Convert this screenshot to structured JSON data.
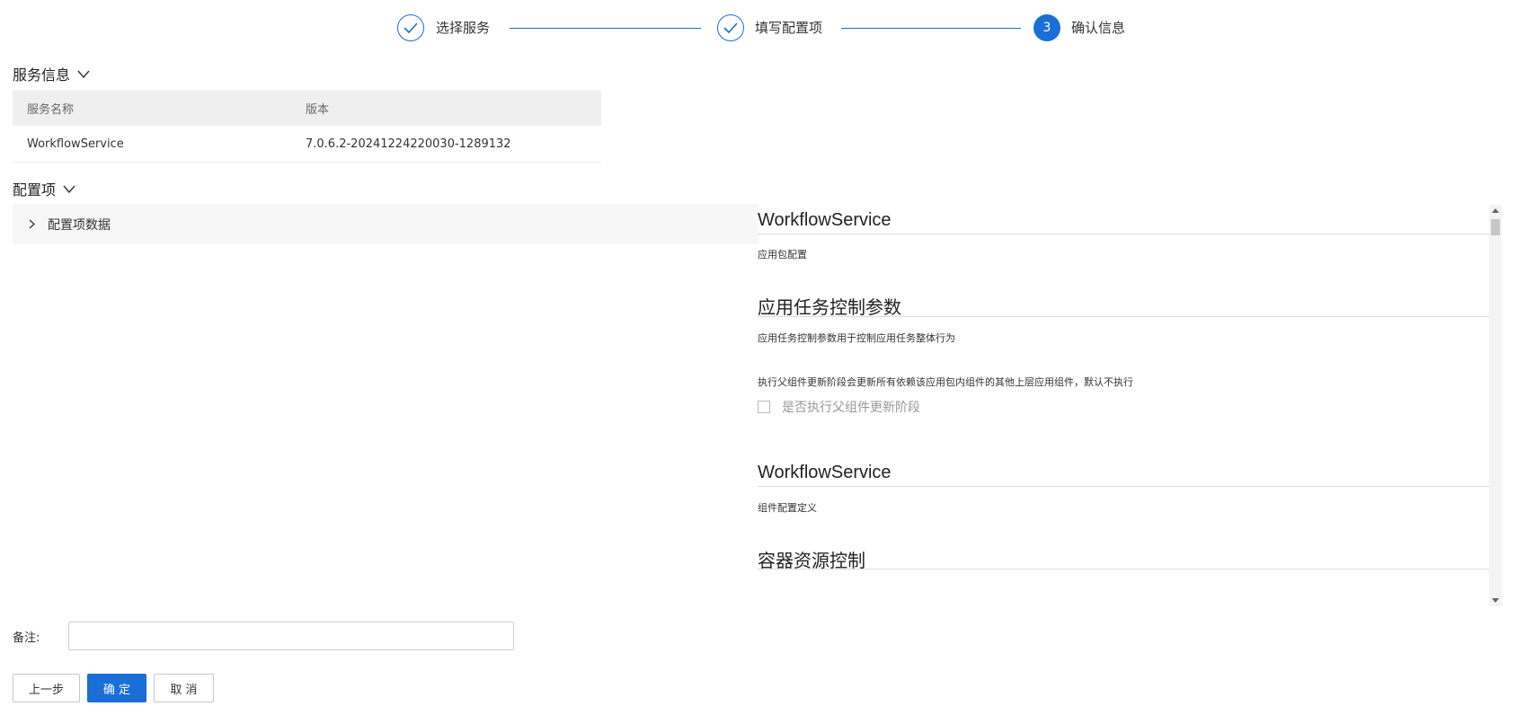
{
  "steps": [
    {
      "label": "选择服务",
      "status": "done"
    },
    {
      "label": "填写配置项",
      "status": "done"
    },
    {
      "label": "确认信息",
      "status": "active",
      "number": "3"
    }
  ],
  "service_info": {
    "title": "服务信息",
    "columns": [
      "服务名称",
      "版本"
    ],
    "rows": [
      {
        "name": "WorkflowService",
        "version": "7.0.6.2-20241224220030-1289132"
      }
    ]
  },
  "config": {
    "title": "配置项",
    "collapse_label": "配置项数据"
  },
  "right_panel": {
    "section1_title": "WorkflowService",
    "section1_desc": "应用包配置",
    "section2_title": "应用任务控制参数",
    "section2_desc": "应用任务控制参数用于控制应用任务整体行为",
    "section2_note": "执行父组件更新阶段会更新所有依赖该应用包内组件的其他上层应用组件，默认不执行",
    "checkbox_label": "是否执行父组件更新阶段",
    "checkbox_checked": false,
    "section3_title": "WorkflowService",
    "section3_desc": "组件配置定义",
    "section4_title": "容器资源控制"
  },
  "remark": {
    "label": "备注:",
    "value": ""
  },
  "buttons": {
    "prev": "上一步",
    "confirm": "确 定",
    "cancel": "取 消"
  },
  "colors": {
    "accent": "#1a6fd6"
  }
}
